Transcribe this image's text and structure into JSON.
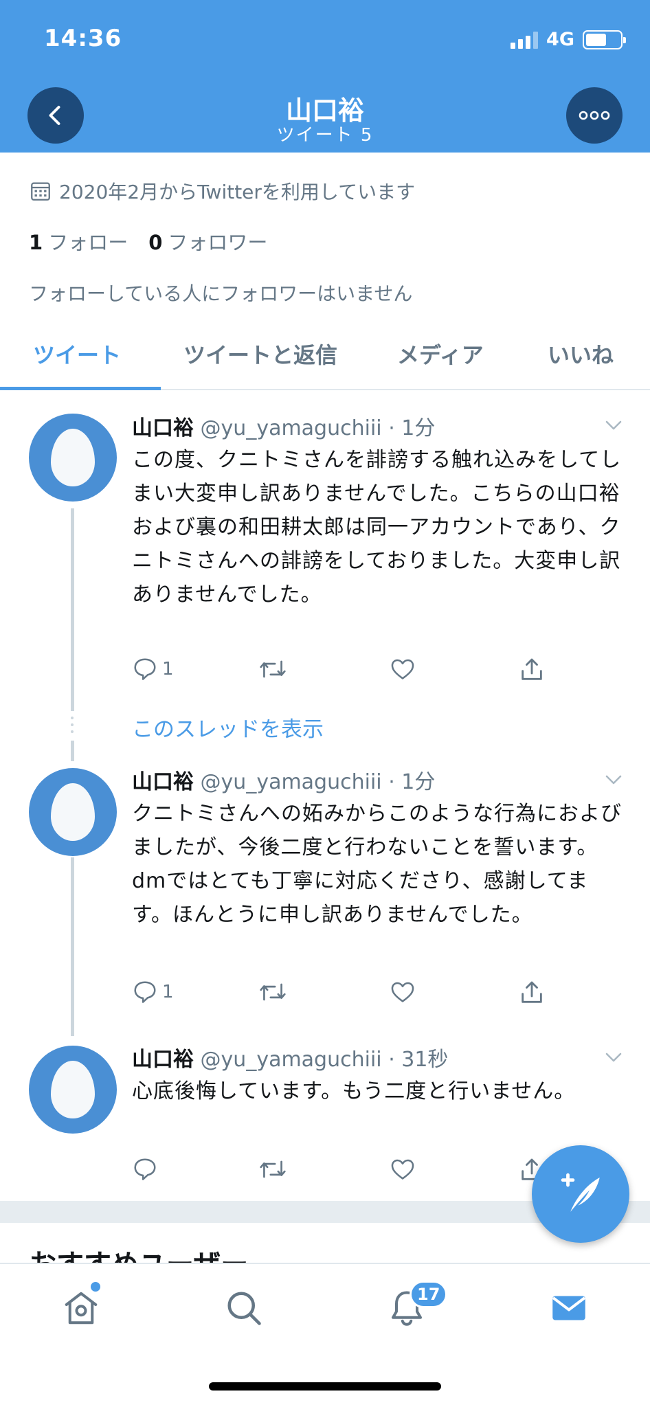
{
  "status_bar": {
    "time": "14:36",
    "network": "4G"
  },
  "header": {
    "title": "山口裕",
    "subtitle": "ツイート 5"
  },
  "profile": {
    "joined": "2020年2月からTwitterを利用しています",
    "following_count": "1",
    "following_label": "フォロー",
    "followers_count": "0",
    "followers_label": "フォロワー",
    "no_common_followers": "フォローしている人にフォロワーはいません"
  },
  "tabs": [
    {
      "label": "ツイート",
      "active": true
    },
    {
      "label": "ツイートと返信",
      "active": false
    },
    {
      "label": "メディア",
      "active": false
    },
    {
      "label": "いいね",
      "active": false
    }
  ],
  "tweets": [
    {
      "name": "山口裕",
      "handle": "@yu_yamaguchiii",
      "time": "· 1分",
      "text": "この度、クニトミさんを誹謗する触れ込みをしてしまい大変申し訳ありませんでした。こちらの山口裕および裏の和田耕太郎は同一アカウントであり、クニトミさんへの誹謗をしておりました。大変申し訳ありませんでした。",
      "reply_count": "1"
    },
    {
      "name": "山口裕",
      "handle": "@yu_yamaguchiii",
      "time": "· 1分",
      "text": "クニトミさんへの妬みからこのような行為におよびましたが、今後二度と行わないことを誓います。dmではとても丁寧に対応くださり、感謝してます。ほんとうに申し訳ありませんでした。",
      "reply_count": "1"
    },
    {
      "name": "山口裕",
      "handle": "@yu_yamaguchiii",
      "time": "· 31秒",
      "text": "心底後悔しています。もう二度と行いません。",
      "reply_count": ""
    }
  ],
  "show_thread": "このスレッドを表示",
  "recommended_users": "おすすめユーザー",
  "notifications_badge": "17",
  "colors": {
    "accent": "#4a9be6",
    "header_bg": "#4a9be6",
    "text_secondary": "#657786"
  },
  "icons": [
    "back-icon",
    "more-icon",
    "calendar-icon",
    "caret-down-icon",
    "reply-icon",
    "retweet-icon",
    "like-icon",
    "share-icon",
    "compose-icon",
    "home-icon",
    "search-icon",
    "bell-icon",
    "mail-icon"
  ]
}
